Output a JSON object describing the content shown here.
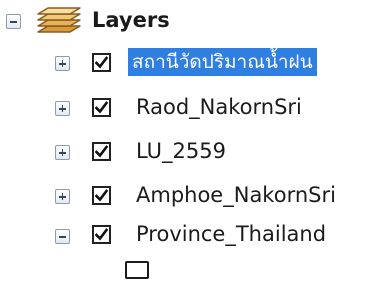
{
  "toc": {
    "root": {
      "label": "Layers",
      "icon": "layers-stack-icon",
      "expanded": true
    },
    "layers": [
      {
        "label": "สถานีวัดปริมาณน้ำฝน",
        "checked": true,
        "expanded": false,
        "selected": true
      },
      {
        "label": "Raod_NakornSri",
        "checked": true,
        "expanded": false,
        "selected": false
      },
      {
        "label": "LU_2559",
        "checked": true,
        "expanded": false,
        "selected": false
      },
      {
        "label": "Amphoe_NakornSri",
        "checked": true,
        "expanded": false,
        "selected": false
      },
      {
        "label": "Province_Thailand",
        "checked": true,
        "expanded": true,
        "selected": false
      }
    ],
    "colors": {
      "selection": "#2f7fe0",
      "layers_icon_fill": "#e6b25a",
      "layers_icon_stroke": "#8a5a1c"
    }
  }
}
